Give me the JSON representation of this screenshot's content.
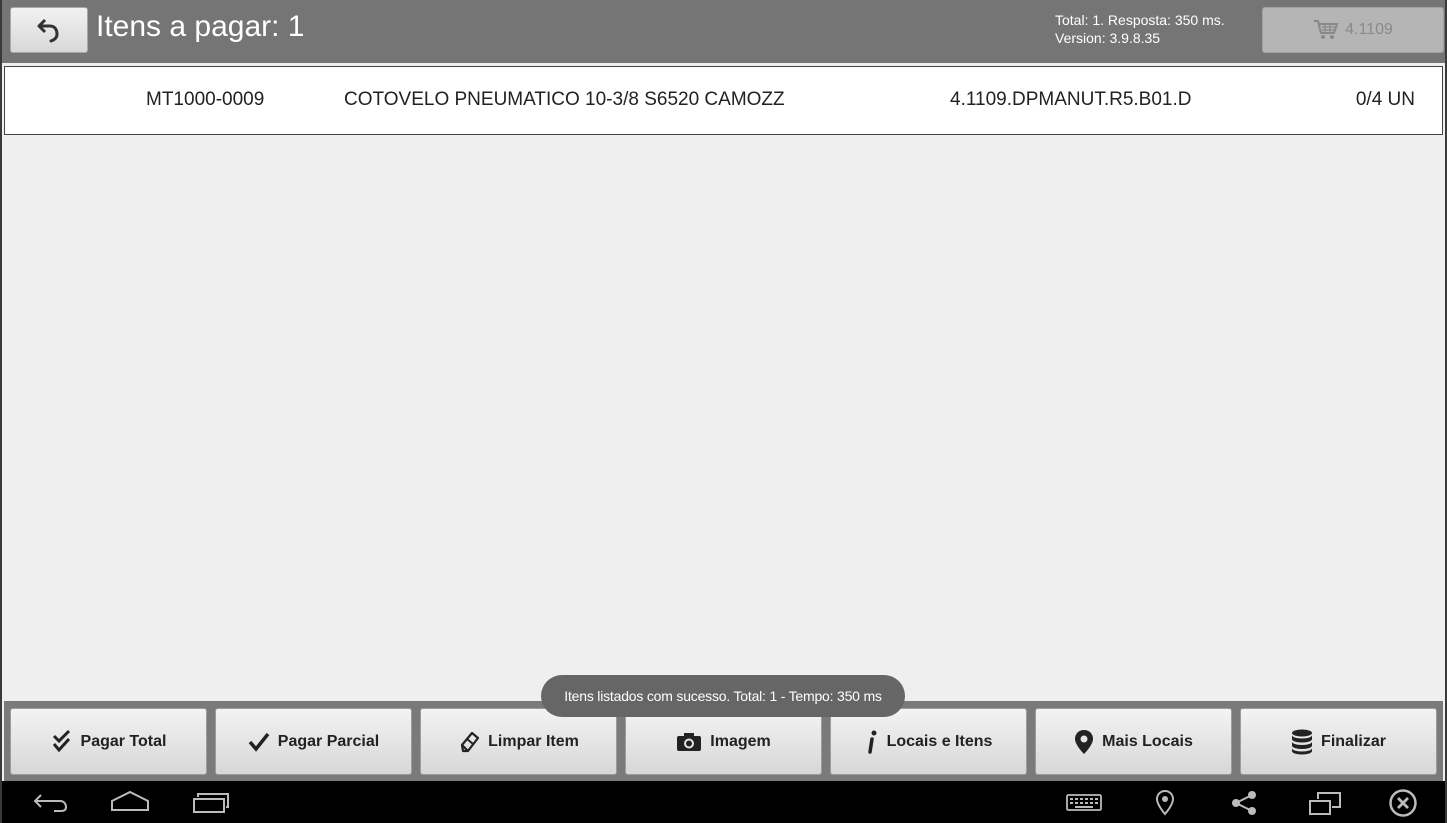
{
  "header": {
    "back_icon": "undo-arrow-icon",
    "title": "Itens a pagar: 1",
    "info_line1": "Total: 1. Resposta: 350 ms.",
    "info_line2": "Version: 3.9.8.35",
    "cart_icon": "cart-icon",
    "cart_label": "4.1109"
  },
  "items": [
    {
      "code": "MT1000-0009",
      "description": "COTOVELO PNEUMATICO 10-3/8 S6520 CAMOZZ",
      "location": "4.1109.DPMANUT.R5.B01.D",
      "quantity": "0/4 UN"
    }
  ],
  "toast": "Itens listados com sucesso. Total: 1 - Tempo: 350 ms",
  "actions": [
    {
      "label": "Pagar Total",
      "icon": "double-check-icon"
    },
    {
      "label": "Pagar Parcial",
      "icon": "check-icon"
    },
    {
      "label": "Limpar Item",
      "icon": "eraser-icon"
    },
    {
      "label": "Imagem",
      "icon": "camera-icon"
    },
    {
      "label": "Locais e Itens",
      "icon": "info-icon"
    },
    {
      "label": "Mais Locais",
      "icon": "map-pin-icon"
    },
    {
      "label": "Finalizar",
      "icon": "database-icon"
    }
  ],
  "navbar": {
    "icons": [
      "back-icon",
      "home-icon",
      "recent-apps-icon",
      "keyboard-icon",
      "location-icon",
      "share-icon",
      "screen-icon",
      "close-icon"
    ]
  },
  "colors": {
    "header_bg": "#757575",
    "actionbar_bg": "#7a7a7a",
    "toast_bg": "#666666",
    "navbar_bg": "#000000"
  }
}
